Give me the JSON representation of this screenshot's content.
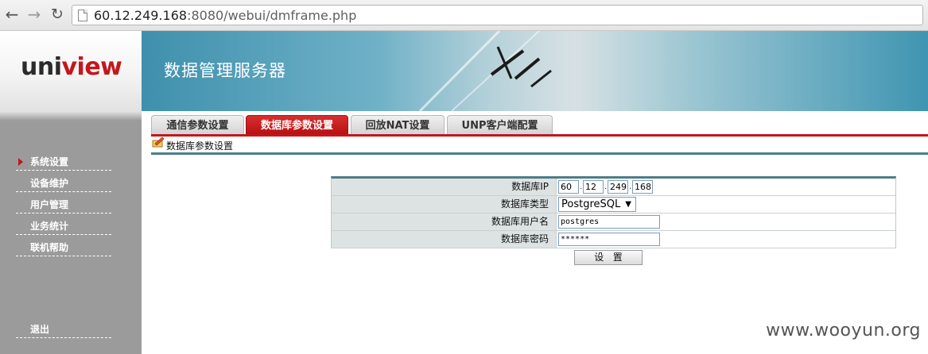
{
  "browser": {
    "url_host": "60.12.249.168",
    "url_rest": ":8080/webui/dmframe.php"
  },
  "logo": {
    "uni": "uni",
    "view": "view"
  },
  "banner": {
    "title": "数据管理服务器"
  },
  "sidebar": {
    "items": [
      {
        "label": "系统设置",
        "active": true
      },
      {
        "label": "设备维护"
      },
      {
        "label": "用户管理"
      },
      {
        "label": "业务统计"
      },
      {
        "label": "联机帮助"
      }
    ],
    "logout": "退出"
  },
  "tabs": [
    {
      "label": "通信参数设置"
    },
    {
      "label": "数据库参数设置",
      "active": true
    },
    {
      "label": "回放NAT设置"
    },
    {
      "label": "UNP客户端配置"
    }
  ],
  "section": {
    "title": "数据库参数设置"
  },
  "form": {
    "ip": {
      "label": "数据库IP",
      "octets": [
        "60",
        "12",
        "249",
        "168"
      ]
    },
    "type": {
      "label": "数据库类型",
      "value": "PostgreSQL"
    },
    "user": {
      "label": "数据库用户名",
      "value": "postgres"
    },
    "password": {
      "label": "数据库密码",
      "value": "******"
    },
    "submit": "设   置"
  },
  "watermark": "www.wooyun.org",
  "colors": {
    "accent": "#c4161c",
    "sidebar": "#9b9b9b",
    "banner": "#3f90ad"
  }
}
